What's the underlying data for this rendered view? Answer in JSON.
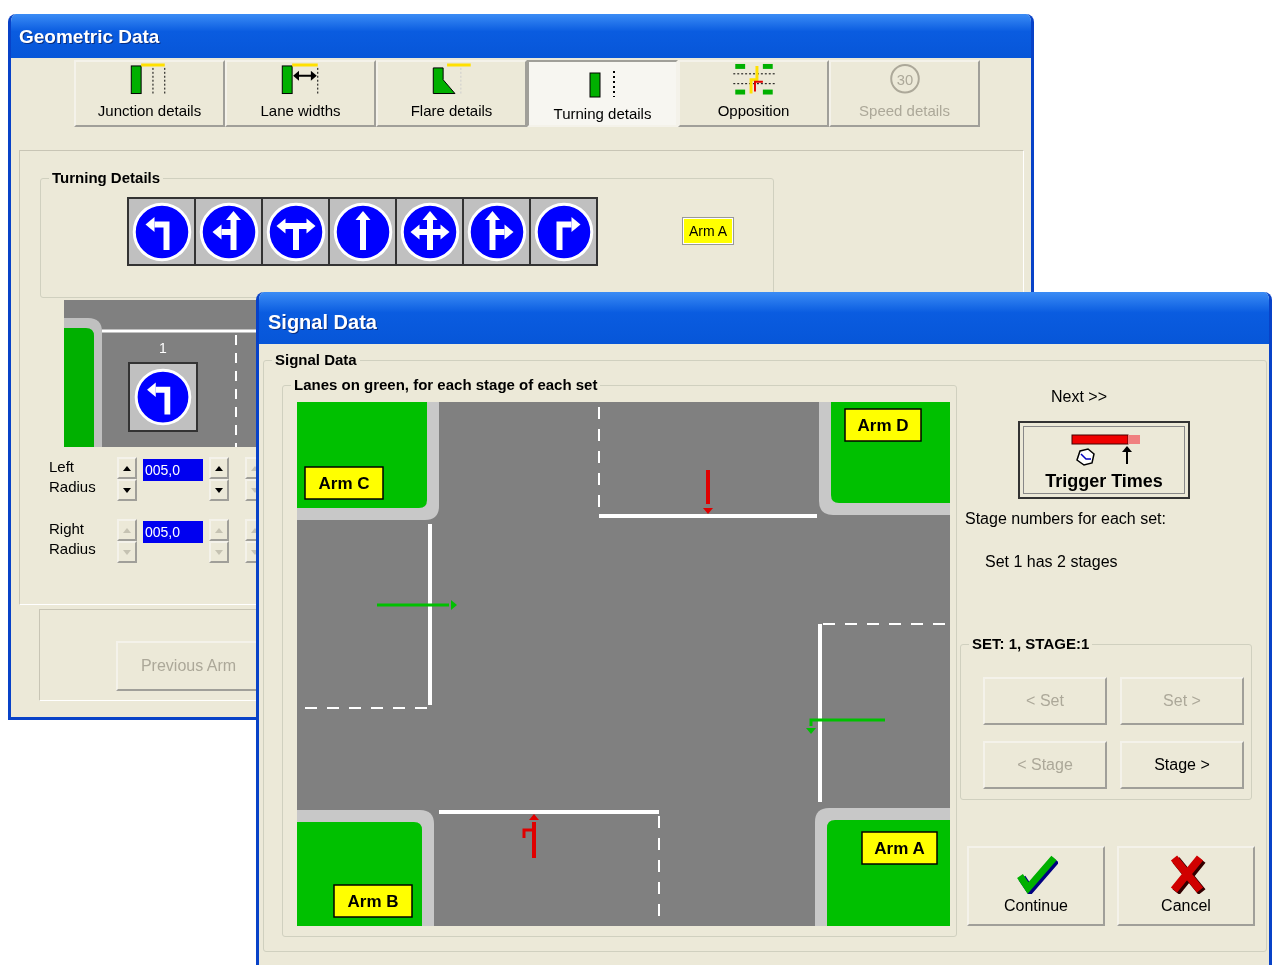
{
  "geometric_window": {
    "title": "Geometric Data",
    "tabs": [
      {
        "label": "Junction details",
        "selected": false,
        "disabled": false
      },
      {
        "label": "Lane widths",
        "selected": false,
        "disabled": false
      },
      {
        "label": "Flare details",
        "selected": false,
        "disabled": false
      },
      {
        "label": "Turning details",
        "selected": true,
        "disabled": false
      },
      {
        "label": "Opposition",
        "selected": false,
        "disabled": false
      },
      {
        "label": "Speed details",
        "selected": false,
        "disabled": true,
        "icon_text": "30"
      }
    ],
    "turning_details": {
      "title": "Turning Details",
      "arm_label": "Arm A"
    },
    "lane_number": "1",
    "radius_rows": [
      {
        "label": "Left Radius",
        "value": "005,0",
        "spinners": [
          {
            "disabled": false
          },
          {
            "disabled": false
          },
          {
            "disabled": true
          }
        ]
      },
      {
        "label": "Right Radius",
        "value": "005,0",
        "spinners": [
          {
            "disabled": true
          },
          {
            "disabled": true
          },
          {
            "disabled": true
          }
        ]
      }
    ],
    "previous_button": {
      "label": "Previous Arm",
      "disabled": true
    }
  },
  "signal_window": {
    "title": "Signal Data",
    "group_title": "Signal Data",
    "lanes_group_title": "Lanes on green, for each stage of each set",
    "arms": [
      {
        "label": "Arm D"
      },
      {
        "label": "Arm C"
      },
      {
        "label": "Arm A"
      },
      {
        "label": "Arm B"
      }
    ],
    "arrows": [
      {
        "on_green": false
      },
      {
        "on_green": true
      },
      {
        "on_green": true
      },
      {
        "on_green": false
      }
    ],
    "next_label": "Next >>",
    "trigger_button": "Trigger Times",
    "stage_numbers_label": "Stage numbers for each set:",
    "sets": [
      "Set 1 has 2 stages"
    ],
    "stage_group": {
      "title": "SET: 1, STAGE:1",
      "buttons": [
        {
          "label": "< Set",
          "disabled": true
        },
        {
          "label": "Set >",
          "disabled": true
        },
        {
          "label": "< Stage",
          "disabled": true
        },
        {
          "label": "Stage >",
          "disabled": false
        }
      ]
    },
    "continue_button": "Continue",
    "cancel_button": "Cancel"
  }
}
